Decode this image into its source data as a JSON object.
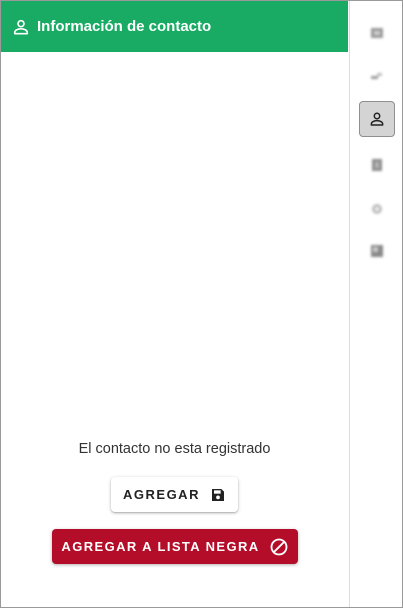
{
  "panel": {
    "title": "Información de contacto",
    "empty_message": "El contacto no esta registrado",
    "add_label": "AGREGAR",
    "blacklist_label": "AGREGAR A LISTA NEGRA"
  },
  "colors": {
    "header_bg": "#19ab63",
    "danger": "#b30d2a",
    "rail_active_bg": "#d4d4d4"
  },
  "icons": {
    "header": "person-icon",
    "add": "save-icon",
    "blacklist": "block-icon",
    "rail": [
      "blurred-icon",
      "blurred-icon",
      "person-icon",
      "blurred-icon",
      "blurred-icon",
      "blurred-icon"
    ]
  },
  "rail": {
    "active_index": 2
  }
}
